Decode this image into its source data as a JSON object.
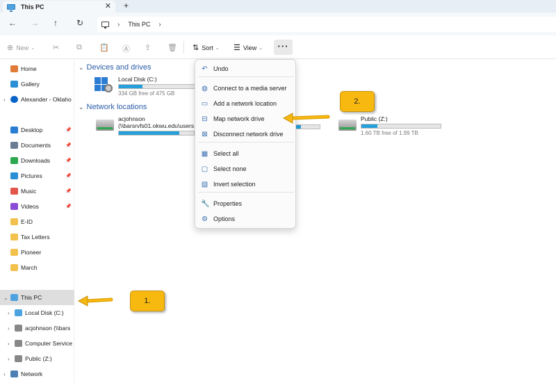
{
  "window": {
    "tab_title": "This PC",
    "close_glyph": "✕",
    "new_tab_glyph": "+"
  },
  "nav": {
    "back": "←",
    "forward": "→",
    "up": "↑",
    "refresh": "↻",
    "chevron": "›",
    "breadcrumb": "This PC"
  },
  "toolbar": {
    "new_label": "New",
    "sort_label": "Sort",
    "view_label": "View",
    "more_label": "···"
  },
  "sidebar": {
    "home": "Home",
    "gallery": "Gallery",
    "onedrive": "Alexander - Oklaho",
    "quick": [
      {
        "label": "Desktop",
        "color": "#2b7cd3"
      },
      {
        "label": "Documents",
        "color": "#6b7d93"
      },
      {
        "label": "Downloads",
        "color": "#2ea84f"
      },
      {
        "label": "Pictures",
        "color": "#2b8fd6"
      },
      {
        "label": "Music",
        "color": "#e2564b"
      },
      {
        "label": "Videos",
        "color": "#8a4bd6"
      },
      {
        "label": "E-ID",
        "color": "#f2c14e"
      },
      {
        "label": "Tax Letters",
        "color": "#f2c14e"
      },
      {
        "label": "Pioneer",
        "color": "#f2c14e"
      },
      {
        "label": "March",
        "color": "#f2c14e"
      }
    ],
    "this_pc": "This PC",
    "drives": [
      {
        "label": "Local Disk (C:)"
      },
      {
        "label": "acjohnson (\\\\bars"
      },
      {
        "label": "Computer Service"
      },
      {
        "label": "Public (Z:)"
      }
    ],
    "network": "Network"
  },
  "content": {
    "devices_title": "Devices and drives",
    "network_title": "Network locations",
    "local_disk": {
      "name": "Local Disk (C:)",
      "free": "334 GB free of 475 GB",
      "used_fraction": 0.3
    },
    "acjohnson": {
      "name": "acjohnson",
      "path": "(\\\\barsrvfs01.okwu.edu\\users...",
      "used_fraction": 0.81
    },
    "public": {
      "name": "Public (Z:)",
      "free": "1.60 TB free of 1.99 TB",
      "used_fraction": 0.2
    }
  },
  "menu": {
    "items": [
      {
        "label": "Undo",
        "icon": "↶"
      },
      {
        "label": "Connect to a media server",
        "icon": "◍"
      },
      {
        "label": "Add a network location",
        "icon": "▭"
      },
      {
        "label": "Map network drive",
        "icon": "⊟"
      },
      {
        "label": "Disconnect network drive",
        "icon": "⊠"
      },
      {
        "label": "Select all",
        "icon": "▦"
      },
      {
        "label": "Select none",
        "icon": "▢"
      },
      {
        "label": "Invert selection",
        "icon": "▧"
      },
      {
        "label": "Properties",
        "icon": "🔧"
      },
      {
        "label": "Options",
        "icon": "⚙"
      }
    ]
  },
  "annotations": {
    "step1": "1.",
    "step2": "2.",
    "arrow_color": "#f2b400"
  }
}
